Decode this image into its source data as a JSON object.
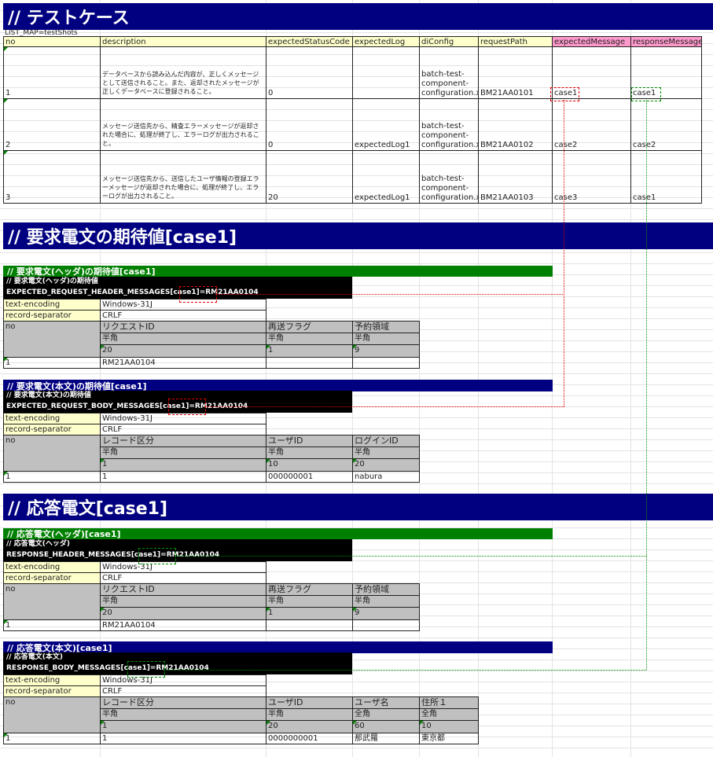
{
  "title_testcase": "// テストケース",
  "list_map": "LIST_MAP=testShots",
  "testcase_headers": [
    "no",
    "description",
    "expectedStatusCode",
    "expectedLog",
    "diConfig",
    "requestPath",
    "expectedMessage",
    "responseMessage"
  ],
  "testcases": [
    {
      "no": "1",
      "description": "データベースから読み込んだ内容が、正しくメッセージとして送信されること。また、返却されたメッセージが正しくデータベースに登録されること。",
      "status": "0",
      "log": "",
      "diconfig": "batch-test-component-configuration.xml",
      "path": "BM21AA0101",
      "expected": "case1",
      "response": "case1"
    },
    {
      "no": "2",
      "description": "メッセージ送信先から、精査エラーメッセージが返却された場合に、処理が終了し、エラーログが出力されること。",
      "status": "0",
      "log": "expectedLog1",
      "diconfig": "batch-test-component-configuration.xml",
      "path": "BM21AA0102",
      "expected": "case2",
      "response": "case2"
    },
    {
      "no": "3",
      "description": "メッセージ送信先から、送信したユーザ情報の登録エラーメッセージが返却された場合に、処理が終了し、エラーログが出力されること。",
      "status": "20",
      "log": "expectedLog1",
      "diconfig": "batch-test-component-configuration.xml",
      "path": "BM21AA0103",
      "expected": "case3",
      "response": "case1"
    }
  ],
  "title_request": "// 要求電文の期待値[case1]",
  "req_header": {
    "section": "// 要求電文(ヘッダ)の期待値[case1]",
    "comment": "// 要求電文(ヘッダ)の期待値",
    "key_prefix": "EXPECTED_REQUEST_HEADER_MESSAGES",
    "key_case": "[case1]",
    "key_suffix": "=RM21AA0104",
    "encoding_label": "text-encoding",
    "encoding": "Windows-31J",
    "separator_label": "record-separator",
    "separator": "CRLF",
    "cols": [
      "no",
      "リクエストID",
      "再送フラグ",
      "予約領域"
    ],
    "types": [
      "",
      "半角",
      "半角",
      "半角"
    ],
    "lengths": [
      "",
      "20",
      "1",
      "9"
    ],
    "row": [
      "1",
      "RM21AA0104",
      "",
      ""
    ]
  },
  "req_body": {
    "section": "// 要求電文(本文)の期待値[case1]",
    "comment": "// 要求電文(本文)の期待値",
    "key_prefix": "EXPECTED_REQUEST_BODY_MESSAGES",
    "key_case": "[case1]",
    "key_suffix": "=RM21AA0104",
    "encoding_label": "text-encoding",
    "encoding": "Windows-31J",
    "separator_label": "record-separator",
    "separator": "CRLF",
    "cols": [
      "no",
      "レコード区分",
      "ユーザID",
      "ログインID"
    ],
    "types": [
      "",
      "半角",
      "半角",
      "半角"
    ],
    "lengths": [
      "",
      "1",
      "10",
      "20"
    ],
    "row": [
      "1",
      "1",
      "000000001",
      "nabura"
    ]
  },
  "title_response": "// 応答電文[case1]",
  "res_header": {
    "section": "// 応答電文(ヘッダ)[case1]",
    "comment": "// 応答電文(ヘッダ)",
    "key_prefix": "RESPONSE_HEADER_MESSAGES",
    "key_case": "[case1]",
    "key_suffix": "=RM21AA0104",
    "encoding_label": "text-encoding",
    "encoding": "Windows-31J",
    "separator_label": "record-separator",
    "separator": "CRLF",
    "cols": [
      "no",
      "リクエストID",
      "再送フラグ",
      "予約領域"
    ],
    "types": [
      "",
      "半角",
      "半角",
      "半角"
    ],
    "lengths": [
      "",
      "20",
      "1",
      "9"
    ],
    "row": [
      "1",
      "RM21AA0104",
      "",
      ""
    ]
  },
  "res_body": {
    "section": "// 応答電文(本文)[case1]",
    "comment": "// 応答電文(本文)",
    "key_prefix": "RESPONSE_BODY_MESSAGES",
    "key_case": "[case1]",
    "key_suffix": "=RM21AA0104",
    "encoding_label": "text-encoding",
    "encoding": "Windows-31J",
    "separator_label": "record-separator",
    "separator": "CRLF",
    "cols": [
      "no",
      "レコード区分",
      "ユーザID",
      "ユーザ名",
      "住所１"
    ],
    "types": [
      "",
      "半角",
      "半角",
      "全角",
      "全角"
    ],
    "lengths": [
      "",
      "1",
      "20",
      "60",
      "10"
    ],
    "row": [
      "1",
      "1",
      "0000000001",
      "那武羅",
      "東京都"
    ]
  },
  "colors": {
    "navy": "#000080",
    "green": "#008000",
    "yellow": "#ffffcc",
    "pink": "#ff99cc",
    "gray": "#c0c0c0",
    "red_link": "#e00000",
    "green_link": "#009000"
  }
}
